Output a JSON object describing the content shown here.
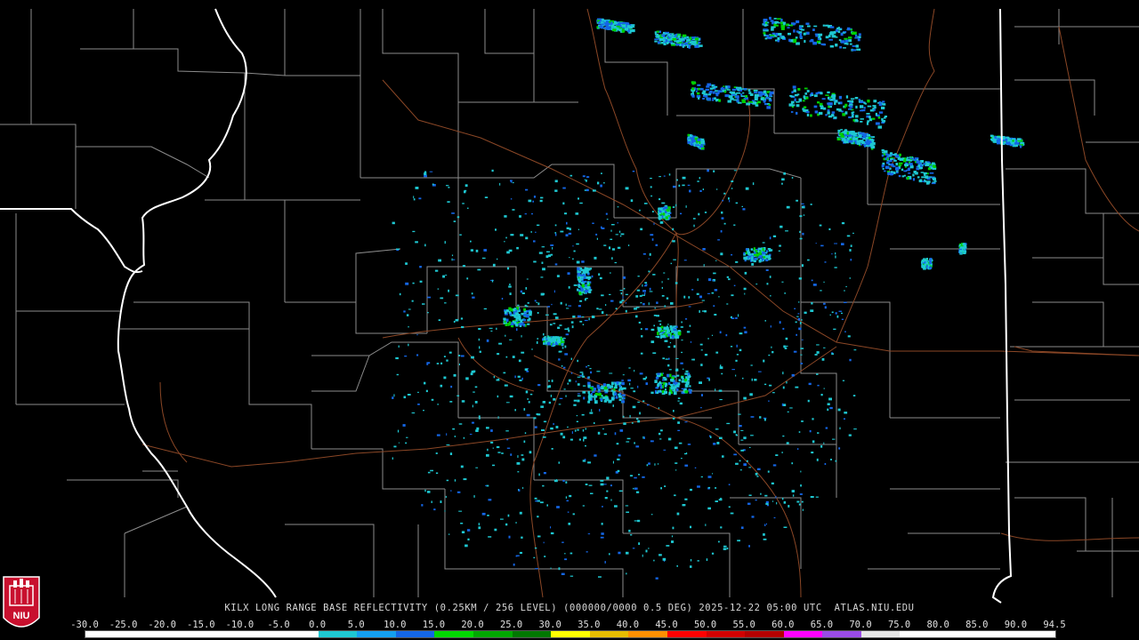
{
  "product": {
    "station": "KILX",
    "caption": "KILX LONG RANGE BASE REFLECTIVITY (0.25KM / 256 LEVEL) (000000/0000 0.5 DEG) 2025-12-22 05:00 UTC  ATLAS.NIU.EDU"
  },
  "logo": {
    "text": "NIU",
    "colors": {
      "background": "#c8102e",
      "foreground": "#ffffff"
    }
  },
  "colorbar": {
    "labels": [
      "-30.0",
      "-25.0",
      "-20.0",
      "-15.0",
      "-10.0",
      "-5.0",
      "0.0",
      "5.0",
      "10.0",
      "15.0",
      "20.0",
      "25.0",
      "30.0",
      "35.0",
      "40.0",
      "45.0",
      "50.0",
      "55.0",
      "60.0",
      "65.0",
      "70.0",
      "75.0",
      "80.0",
      "85.0",
      "90.0",
      "94.5"
    ],
    "colors": [
      "#ffffff",
      "#ffffff",
      "#ffffff",
      "#ffffff",
      "#ffffff",
      "#ffffff",
      "#1ec8d2",
      "#14a0f0",
      "#1466e6",
      "#00d800",
      "#00a800",
      "#007800",
      "#ffff00",
      "#e6bc00",
      "#ff9000",
      "#ff0000",
      "#d20000",
      "#b40000",
      "#ff00ff",
      "#9a4ce6",
      "#e6e6e6",
      "#ffffff",
      "#ffffff",
      "#ffffff",
      "#ffffff"
    ]
  },
  "map_colors": {
    "state_border": "#ffffff",
    "county_border": "#9a9a9a",
    "highway": "#a0522d",
    "echo_light": "#1ec8d2",
    "echo_med": "#1466e6",
    "echo_heavy": "#00d000"
  }
}
